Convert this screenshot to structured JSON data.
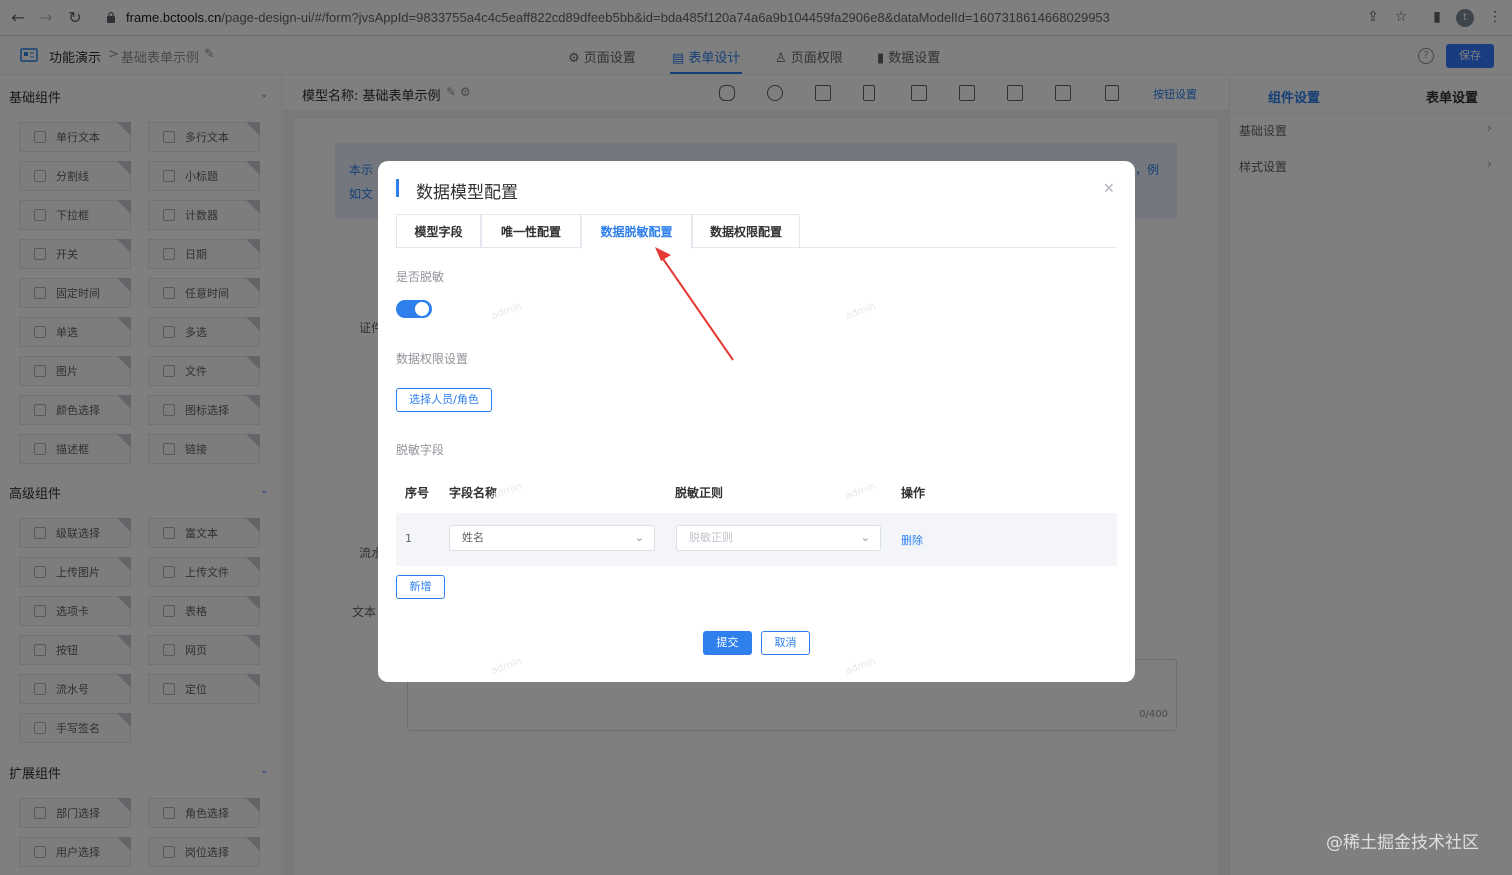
{
  "browser": {
    "url_host": "frame.bctools.cn",
    "url_path": "/page-design-ui/#/form?jvsAppId=9833755a4c4c5eaff822cd89dfeeb5bb&id=bda485f120a74a6a9b104459fa2906e8&dataModelId=1607318614668029953",
    "profile_initial": "t"
  },
  "header": {
    "app_name": "功能演示",
    "separator": ">",
    "page_name": "基础表单示例",
    "tabs": [
      {
        "label": "页面设置",
        "icon": "gear-icon"
      },
      {
        "label": "表单设计",
        "icon": "document-icon"
      },
      {
        "label": "页面权限",
        "icon": "user-icon"
      },
      {
        "label": "数据设置",
        "icon": "bar-chart-icon"
      }
    ],
    "active_tab": "表单设计",
    "save_label": "保存"
  },
  "left": {
    "groups": [
      {
        "title": "基础组件",
        "items": [
          "单行文本",
          "多行文本",
          "分割线",
          "小标题",
          "下拉框",
          "计数器",
          "开关",
          "日期",
          "固定时间",
          "任意时间",
          "单选",
          "多选",
          "图片",
          "文件",
          "颜色选择",
          "图标选择",
          "描述框",
          "链接"
        ]
      },
      {
        "title": "高级组件",
        "items": [
          "级联选择",
          "富文本",
          "上传图片",
          "上传文件",
          "选项卡",
          "表格",
          "按钮",
          "网页",
          "流水号",
          "定位",
          "手写签名"
        ]
      },
      {
        "title": "扩展组件",
        "items": [
          "部门选择",
          "角色选择",
          "用户选择",
          "岗位选择"
        ]
      }
    ]
  },
  "canvas": {
    "model_label": "模型名称: 基础表单示例",
    "button_settings": "按钮设置",
    "info_text_left": "本示",
    "info_text_left2": "如文",
    "info_text_right": "，例",
    "bg_labels": [
      "证件",
      "流水",
      "文本"
    ],
    "char_count": "0/400"
  },
  "right": {
    "tabs": [
      "组件设置",
      "表单设置"
    ],
    "active_tab": "组件设置",
    "rows": [
      "基础设置",
      "样式设置"
    ]
  },
  "dialog": {
    "title": "数据模型配置",
    "tabs": [
      "模型字段",
      "唯一性配置",
      "数据脱敏配置",
      "数据权限配置"
    ],
    "active_tab": "数据脱敏配置",
    "desensitize_label": "是否脱敏",
    "desensitize_on": true,
    "permission_label": "数据权限设置",
    "select_button": "选择人员/角色",
    "fields_label": "脱敏字段",
    "table": {
      "headers": [
        "序号",
        "字段名称",
        "脱敏正则",
        "操作"
      ],
      "rows": [
        {
          "index": "1",
          "field": "姓名",
          "regex_placeholder": "脱敏正则",
          "action": "删除"
        }
      ]
    },
    "add_button": "新增",
    "submit_button": "提交",
    "cancel_button": "取消"
  },
  "watermark": {
    "site": "@稀土掘金技术社区",
    "user": "admin"
  },
  "colors": {
    "accent": "#2f80ed",
    "overlay": "rgba(0,0,0,0.5)",
    "arrow": "#e53935"
  }
}
